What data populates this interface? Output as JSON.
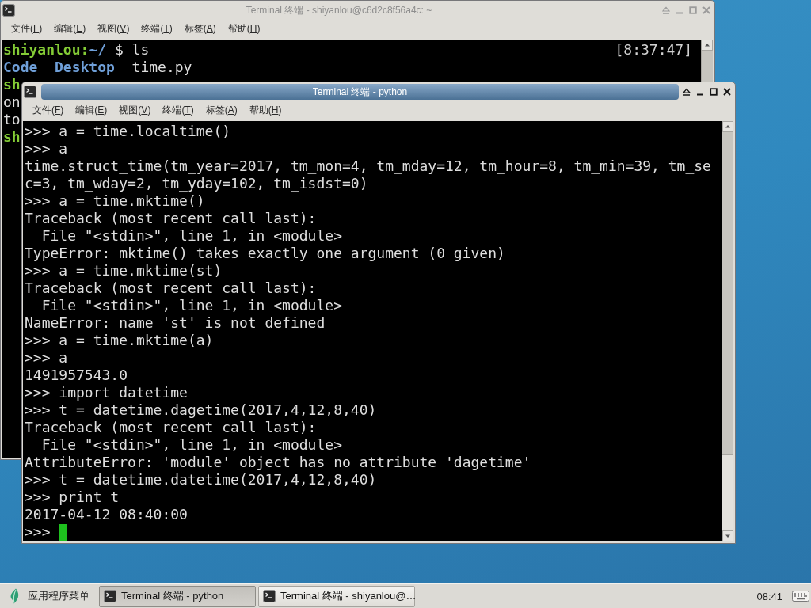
{
  "windows": [
    {
      "title": "Terminal 终端 - shiyanlou@c6d2c8f56a4c: ~",
      "active": false,
      "menu": [
        {
          "label": "文件(",
          "key": "F",
          "end": ")"
        },
        {
          "label": "编辑(",
          "key": "E",
          "end": ")"
        },
        {
          "label": "视图(",
          "key": "V",
          "end": ")"
        },
        {
          "label": "终端(",
          "key": "T",
          "end": ")"
        },
        {
          "label": "标签(",
          "key": "A",
          "end": ")"
        },
        {
          "label": "帮助(",
          "key": "H",
          "end": ")"
        }
      ],
      "lines": [
        {
          "segments": [
            {
              "text": "shiyanlou:",
              "kind": "user"
            },
            {
              "text": "~/",
              "kind": "path"
            },
            {
              "text": " $ ls",
              "kind": "plain"
            }
          ],
          "timestamp": "[8:37:47]"
        },
        {
          "segments": [
            {
              "text": "Code  Desktop",
              "kind": "dir"
            },
            {
              "text": "  time.py",
              "kind": "plain"
            }
          ]
        },
        {
          "segments": [
            {
              "text": "sh",
              "kind": "user"
            }
          ]
        },
        {
          "text": "on"
        },
        {
          "text": "to"
        },
        {
          "segments": [
            {
              "text": "sh",
              "kind": "user"
            }
          ]
        }
      ]
    },
    {
      "title": "Terminal 终端 - python",
      "active": true,
      "menu": [
        {
          "label": "文件(",
          "key": "F",
          "end": ")"
        },
        {
          "label": "编辑(",
          "key": "E",
          "end": ")"
        },
        {
          "label": "视图(",
          "key": "V",
          "end": ")"
        },
        {
          "label": "终端(",
          "key": "T",
          "end": ")"
        },
        {
          "label": "标签(",
          "key": "A",
          "end": ")"
        },
        {
          "label": "帮助(",
          "key": "H",
          "end": ")"
        }
      ],
      "lines": [
        {
          "text": ">>> a = time.localtime()",
          "cursor": false
        },
        {
          "text": ">>> a",
          "cursor": false
        },
        {
          "text": "time.struct_time(tm_year=2017, tm_mon=4, tm_mday=12, tm_hour=8, tm_min=39, tm_se",
          "cursor": false
        },
        {
          "text": "c=3, tm_wday=2, tm_yday=102, tm_isdst=0)",
          "cursor": false
        },
        {
          "text": ">>> a = time.mktime()",
          "cursor": false
        },
        {
          "text": "Traceback (most recent call last):",
          "cursor": false
        },
        {
          "text": "  File \"<stdin>\", line 1, in <module>",
          "cursor": false
        },
        {
          "text": "TypeError: mktime() takes exactly one argument (0 given)",
          "cursor": false
        },
        {
          "text": ">>> a = time.mktime(st)",
          "cursor": false
        },
        {
          "text": "Traceback (most recent call last):",
          "cursor": false
        },
        {
          "text": "  File \"<stdin>\", line 1, in <module>",
          "cursor": false
        },
        {
          "text": "NameError: name 'st' is not defined",
          "cursor": false
        },
        {
          "text": ">>> a = time.mktime(a)",
          "cursor": false
        },
        {
          "text": ">>> a",
          "cursor": false
        },
        {
          "text": "1491957543.0",
          "cursor": false
        },
        {
          "text": ">>> import datetime",
          "cursor": false
        },
        {
          "text": ">>> t = datetime.dagetime(2017,4,12,8,40)",
          "cursor": false
        },
        {
          "text": "Traceback (most recent call last):",
          "cursor": false
        },
        {
          "text": "  File \"<stdin>\", line 1, in <module>",
          "cursor": false
        },
        {
          "text": "AttributeError: 'module' object has no attribute 'dagetime'",
          "cursor": false
        },
        {
          "text": ">>> t = datetime.datetime(2017,4,12,8,40)",
          "cursor": false
        },
        {
          "text": ">>> print t",
          "cursor": false
        },
        {
          "text": "2017-04-12 08:40:00",
          "cursor": false
        },
        {
          "text": ">>> ",
          "cursor": true
        }
      ]
    }
  ],
  "taskbar": {
    "app_menu": "应用程序菜单",
    "tasks": [
      {
        "label": "Terminal 终端 - python",
        "selected": true
      },
      {
        "label": "Terminal 终端 - shiyanlou@…",
        "selected": false
      }
    ],
    "clock": "08:41"
  }
}
